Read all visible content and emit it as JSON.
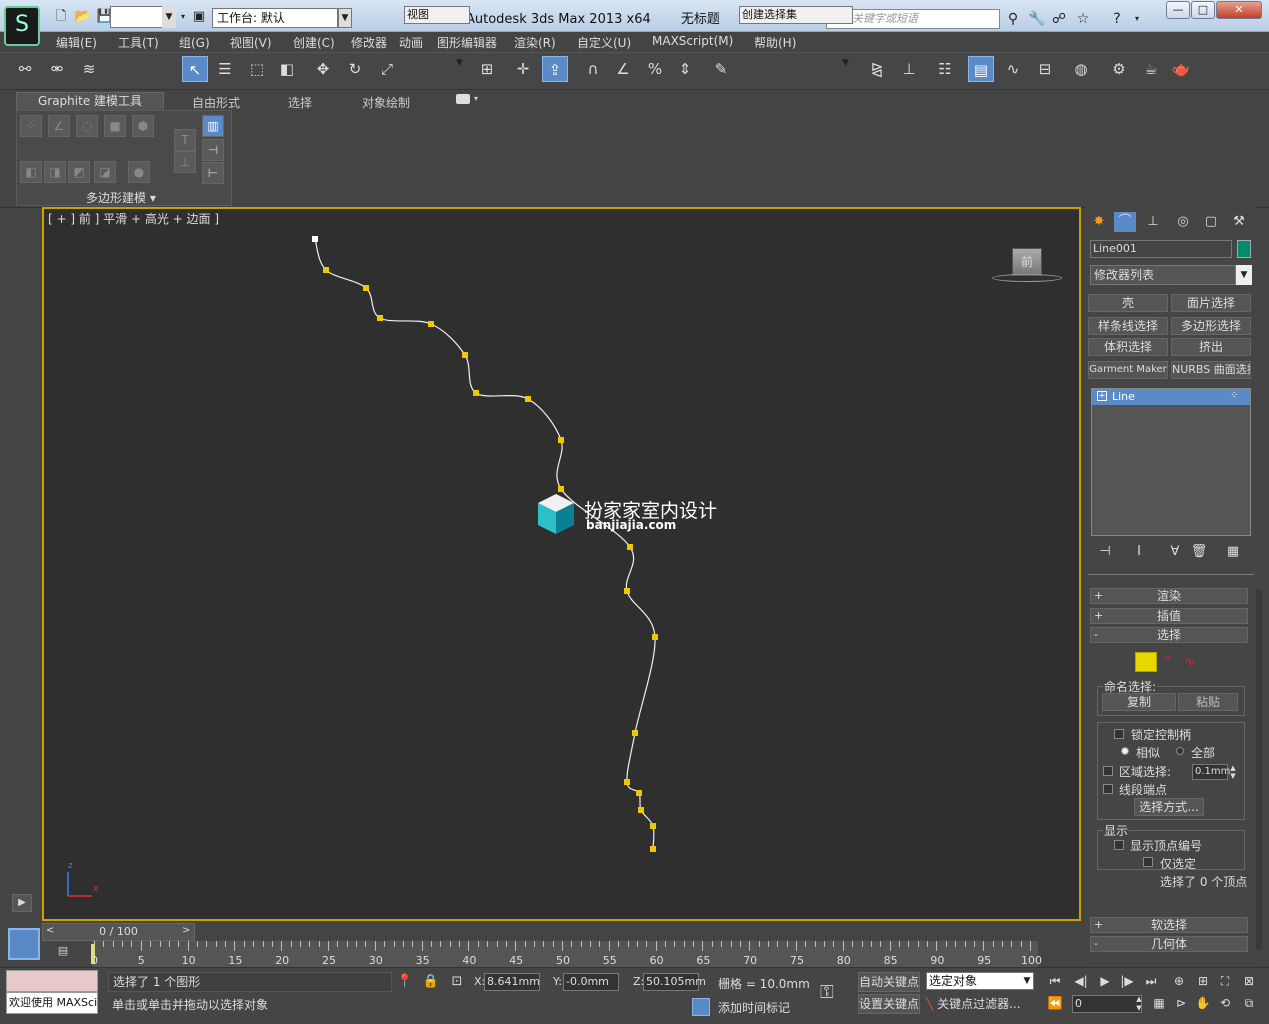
{
  "titlebar": {
    "logo_glyph": "S",
    "workspace_label": "工作台: 默认",
    "app_title": "Autodesk 3ds Max  2013 x64",
    "doc_title": "无标题",
    "search_placeholder": "键入关键字或短语",
    "win_buttons": {
      "minimize": "—",
      "maximize": "□",
      "close": "✕"
    }
  },
  "menu": [
    "编辑(E)",
    "工具(T)",
    "组(G)",
    "视图(V)",
    "创建(C)",
    "修改器",
    "动画",
    "图形编辑器",
    "渲染(R)",
    "自定义(U)",
    "MAXScript(M)",
    "帮助(H)"
  ],
  "toolbar": {
    "ref_coord": "视图",
    "named_selection": "创建选择集"
  },
  "ribbon": {
    "tabs": [
      "Graphite 建模工具",
      "自由形式",
      "选择",
      "对象绘制"
    ],
    "panel_label": "多边形建模 ▾"
  },
  "viewport": {
    "label": "[ + ] 前 ] 平滑 + 高光 + 边面 ]",
    "viewcube_label": "前",
    "watermark_cn": "扮家家室内设计",
    "watermark_en": "banjiajia.com",
    "spline_points": [
      [
        315,
        239
      ],
      [
        326,
        270
      ],
      [
        366,
        288
      ],
      [
        380,
        318
      ],
      [
        431,
        324
      ],
      [
        465,
        355
      ],
      [
        476,
        393
      ],
      [
        528,
        399
      ],
      [
        561,
        440
      ],
      [
        561,
        489
      ],
      [
        630,
        547
      ],
      [
        627,
        591
      ],
      [
        655,
        637
      ],
      [
        635,
        733
      ],
      [
        627,
        782
      ],
      [
        639,
        793
      ],
      [
        641,
        810
      ],
      [
        653,
        826
      ],
      [
        653,
        849
      ]
    ],
    "axis": {
      "z": "z",
      "x": "x"
    }
  },
  "command_panel": {
    "object_name": "Line001",
    "object_color": "#008c6e",
    "modifier_list": "修改器列表",
    "modifier_buttons": [
      "壳",
      "面片选择",
      "样条线选择",
      "多边形选择",
      "体积选择",
      "挤出",
      "Garment Maker",
      "NURBS 曲面选择"
    ],
    "stack_item": "Line",
    "rollouts": {
      "render": "渲染",
      "interp": "插值",
      "selection": "选择",
      "soft_sel": "软选择",
      "geometry": "几何体"
    },
    "named_sel_label": "命名选择:",
    "copy_btn": "复制",
    "paste_btn": "粘贴",
    "lock_handles": "锁定控制柄",
    "alike": "相似",
    "all": "全部",
    "area_sel": "区域选择:",
    "area_value": "0.1mm",
    "seg_end": "线段端点",
    "sel_method": "选择方式...",
    "display_label": "显示",
    "show_vertex_nums": "显示顶点编号",
    "only_selected": "仅选定",
    "selected_count": "选择了 0 个顶点"
  },
  "timeline": {
    "slider": "0 / 100",
    "ticks": [
      "0",
      "5",
      "10",
      "15",
      "20",
      "25",
      "30",
      "35",
      "40",
      "45",
      "50",
      "55",
      "60",
      "65",
      "70",
      "75",
      "80",
      "85",
      "90",
      "95",
      "100"
    ]
  },
  "status": {
    "maxscript": "欢迎使用 MAXSci",
    "selected": "选择了 1 个图形",
    "prompt": "单击或单击并拖动以选择对象",
    "x_value": "8.641mm",
    "y_value": "-0.0mm",
    "z_value": "50.105mm",
    "grid": "栅格 = 10.0mm",
    "add_time_tag": "添加时间标记",
    "auto_key": "自动关键点",
    "set_key": "设置关键点",
    "key_mode": "选定对象",
    "key_filters": "关键点过滤器...",
    "frame": "0"
  }
}
